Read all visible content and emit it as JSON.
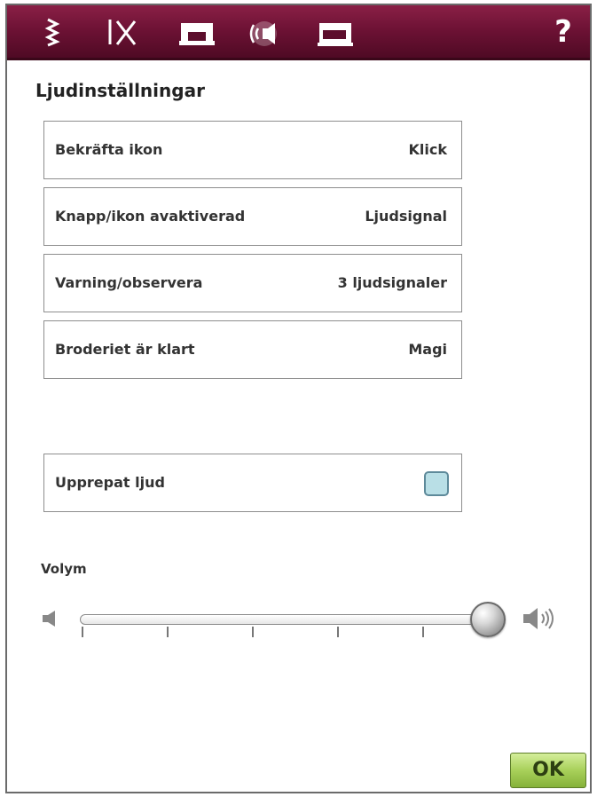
{
  "topbar": {
    "tabs": [
      {
        "name": "stitch-settings",
        "icon": "zigzag-stitch-icon",
        "active": false
      },
      {
        "name": "sewing-settings",
        "icon": "needle-scissors-icon",
        "active": false
      },
      {
        "name": "machine-settings",
        "icon": "sewing-machine-icon",
        "active": false
      },
      {
        "name": "sound-settings",
        "icon": "speaker-icon",
        "active": true
      },
      {
        "name": "embroidery-settings",
        "icon": "embroidery-machine-icon",
        "active": false
      }
    ],
    "help_label": "?"
  },
  "title": "Ljudinställningar",
  "settings": [
    {
      "label": "Bekräfta ikon",
      "value": "Klick"
    },
    {
      "label": "Knapp/ikon avaktiverad",
      "value": "Ljudsignal"
    },
    {
      "label": "Varning/observera",
      "value": "3 ljudsignaler"
    },
    {
      "label": "Broderiet är klart",
      "value": "Magi"
    }
  ],
  "repeat_sound": {
    "label": "Upprepat ljud",
    "checked": false
  },
  "volume": {
    "label": "Volym",
    "level": 1.0,
    "ticks": 5
  },
  "colors": {
    "topbar": "#6e1235",
    "checkbox_fill": "#b9dfe6",
    "ok_button": "#a8d05a"
  },
  "ok_label": "OK"
}
